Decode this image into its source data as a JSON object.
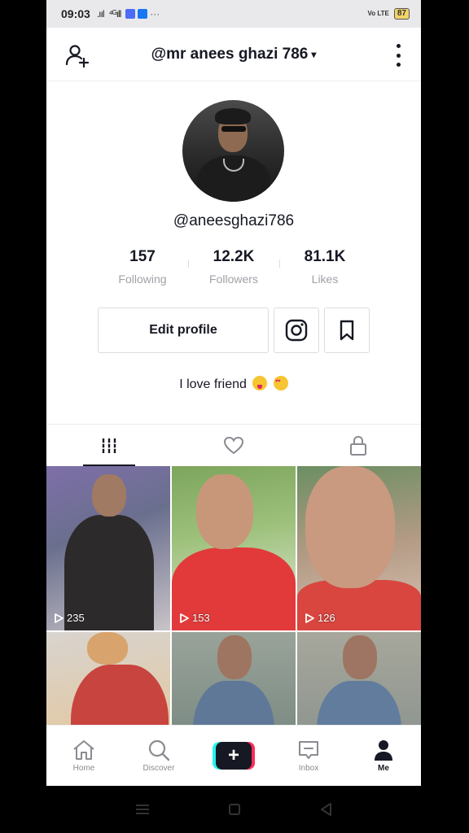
{
  "status_bar": {
    "time": "09:03",
    "signal1": ".ııl",
    "signal2": "⁴ᴳıll",
    "more": "···",
    "volte": "Vo LTE",
    "battery": "87"
  },
  "header": {
    "title": "@mr anees ghazi 786",
    "caret": "▾"
  },
  "profile": {
    "handle": "@aneesghazi786",
    "stats": [
      {
        "value": "157",
        "label": "Following"
      },
      {
        "value": "12.2K",
        "label": "Followers"
      },
      {
        "value": "81.1K",
        "label": "Likes"
      }
    ],
    "edit_label": "Edit profile",
    "bio": "I love friend"
  },
  "videos": [
    {
      "views": "235"
    },
    {
      "views": "153"
    },
    {
      "views": "126"
    },
    {
      "views": ""
    },
    {
      "views": ""
    },
    {
      "views": ""
    }
  ],
  "bottom_nav": {
    "home": "Home",
    "discover": "Discover",
    "create": "+",
    "inbox": "Inbox",
    "me": "Me"
  },
  "colors": {
    "text": "#161823",
    "muted": "#a0a1a7",
    "accent_cyan": "#25f4ee",
    "accent_red": "#fe2c55"
  }
}
